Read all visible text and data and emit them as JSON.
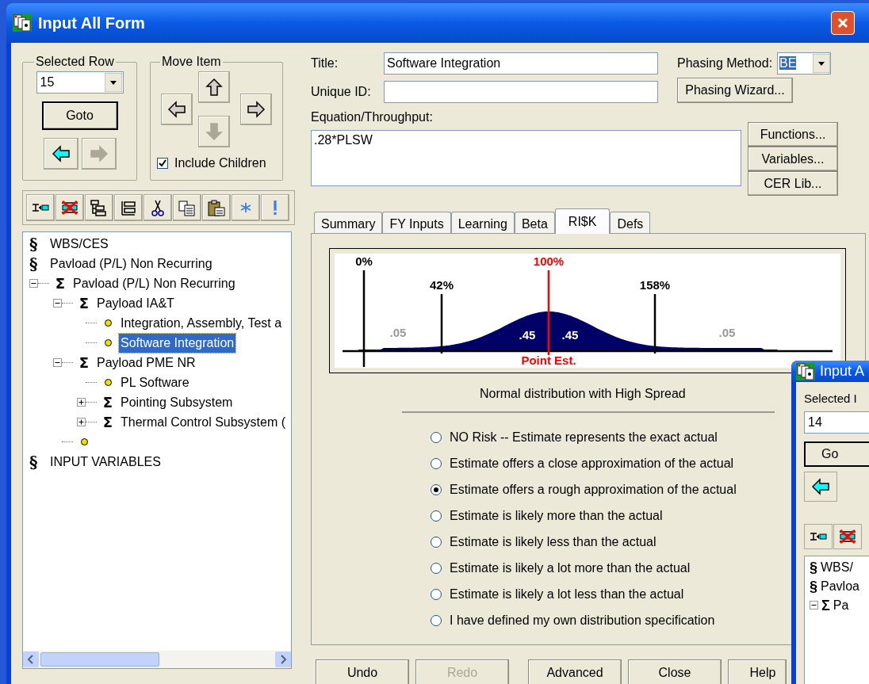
{
  "window": {
    "title": "Input All Form"
  },
  "selected_row": {
    "label": "Selected Row",
    "value": "15",
    "goto": "Goto"
  },
  "move_item": {
    "label": "Move Item",
    "include_children": {
      "label": "Include Children",
      "checked": true
    }
  },
  "tree": [
    {
      "kind": "section",
      "symbol": "§",
      "label": "WBS/CES"
    },
    {
      "kind": "section",
      "symbol": "§",
      "label": "Pavload (P/L) Non Recurring"
    },
    {
      "kind": "sum",
      "symbol": "Σ",
      "label": "Pavload (P/L) Non Recurring",
      "expanded": true,
      "children": [
        {
          "kind": "sum",
          "symbol": "Σ",
          "label": "Payload IA&T",
          "expanded": true,
          "children": [
            {
              "kind": "item",
              "label": "Integration, Assembly, Test a",
              "selected": false
            },
            {
              "kind": "item",
              "label": "Software Integration",
              "selected": true
            }
          ]
        },
        {
          "kind": "sum",
          "symbol": "Σ",
          "label": "Payload PME NR",
          "expanded": true,
          "children": [
            {
              "kind": "item",
              "label": "PL Software",
              "selected": false
            },
            {
              "kind": "sum",
              "symbol": "Σ",
              "label": "Pointing Subsystem",
              "expanded": false
            },
            {
              "kind": "sum",
              "symbol": "Σ",
              "label": "Thermal Control Subsystem (",
              "expanded": false
            }
          ]
        },
        {
          "kind": "item"
        }
      ]
    },
    {
      "kind": "section",
      "symbol": "§",
      "label": "INPUT VARIABLES"
    }
  ],
  "title_field": {
    "label": "Title:",
    "value": "Software Integration"
  },
  "unique_id": {
    "label": "Unique ID:"
  },
  "phasing_method": {
    "label": "Phasing Method:",
    "value": "BE",
    "wizard": "Phasing Wizard..."
  },
  "equation": {
    "label": "Equation/Throughput:",
    "value": ".28*PLSW"
  },
  "side_buttons": [
    "Functions...",
    "Variables...",
    "CER Lib..."
  ],
  "tabs": [
    {
      "label": "Summary",
      "selected": false
    },
    {
      "label": "FY Inputs",
      "selected": false
    },
    {
      "label": "Learning",
      "selected": false
    },
    {
      "label": "Beta",
      "selected": false
    },
    {
      "label": "RI$K",
      "selected": true
    },
    {
      "label": "Defs",
      "selected": false
    }
  ],
  "risk_chart": {
    "markers": [
      {
        "label": "0%",
        "kind": "low"
      },
      {
        "label": "42%",
        "kind": "mid"
      },
      {
        "label": "100%",
        "kind": "point"
      },
      {
        "label": "158%",
        "kind": "mid"
      }
    ],
    "areas": [
      ".05",
      ".45",
      ".45",
      ".05"
    ],
    "point_label": "Point Est.",
    "caption": "Normal distribution with High Spread"
  },
  "risk_options": [
    {
      "label": "NO Risk -- Estimate represents the exact actual",
      "selected": false
    },
    {
      "label": "Estimate offers a close approximation of the actual",
      "selected": false
    },
    {
      "label": "Estimate offers a rough approximation of the actual",
      "selected": true
    },
    {
      "label": "Estimate is likely more than the actual",
      "selected": false
    },
    {
      "label": "Estimate is likely less than the actual",
      "selected": false
    },
    {
      "label": "Estimate is likely a lot more than the actual",
      "selected": false
    },
    {
      "label": "Estimate is likely a lot less than the actual",
      "selected": false
    },
    {
      "label": "I have defined my own distribution specification",
      "selected": false
    }
  ],
  "footer_buttons": [
    {
      "label": "Undo",
      "disabled": false
    },
    {
      "label": "Redo",
      "disabled": true
    },
    {
      "label": "Advanced",
      "disabled": false
    },
    {
      "label": "Close",
      "disabled": false
    },
    {
      "label": "Help",
      "disabled": false
    }
  ],
  "second_window": {
    "title": "Input A",
    "selected_row_label": "Selected I",
    "value": "14",
    "goto": "Go",
    "tree": [
      {
        "symbol": "§",
        "label": "WBS/"
      },
      {
        "symbol": "§",
        "label": "Pavloa"
      },
      {
        "symbol": "Σ",
        "label": "Pa"
      }
    ]
  }
}
